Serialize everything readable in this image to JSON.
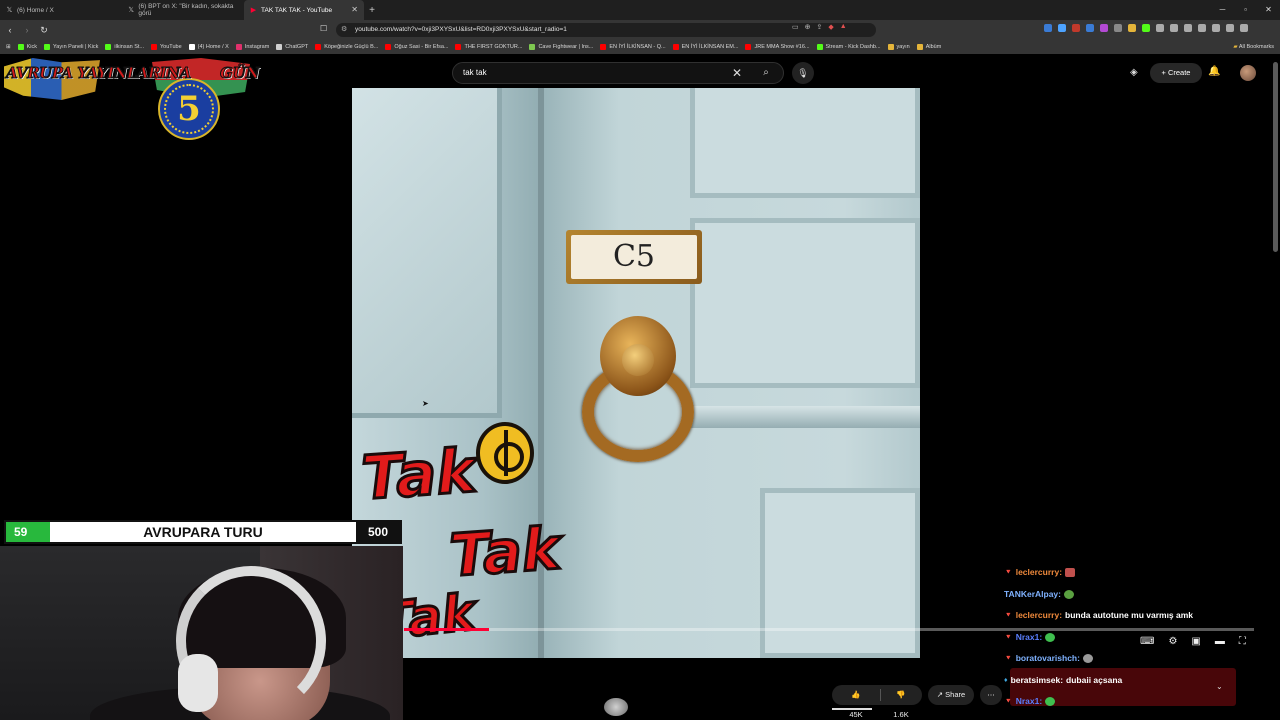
{
  "browser": {
    "tabs": [
      {
        "label": "(6) Home / X",
        "icon": "x-logo-icon",
        "active": false
      },
      {
        "label": "(6) BPT on X: \"Bir kadın, sokakta görü",
        "icon": "x-logo-icon",
        "active": false
      },
      {
        "label": "TAK TAK TAK - YouTube",
        "icon": "youtube-icon",
        "active": true
      }
    ],
    "new_tab": "+",
    "url": "youtube.com/watch?v=0xji3PXYSxU&list=RD0xji3PXYSxU&start_radio=1",
    "bookmarks": [
      {
        "label": "Kick",
        "color": "#53fc18"
      },
      {
        "label": "Yayın Paneli | Kick",
        "color": "#53fc18"
      },
      {
        "label": "ilkinsan St...",
        "color": "#53fc18"
      },
      {
        "label": "YouTube",
        "color": "#ff0000"
      },
      {
        "label": "(4) Home / X",
        "color": "#ffffff"
      },
      {
        "label": "Instagram",
        "color": "#e1306c"
      },
      {
        "label": "ChatGPT",
        "color": "#cfcfcf"
      },
      {
        "label": "Köpeğinizle Güçlü B...",
        "color": "#ff0000"
      },
      {
        "label": "Oğuz Sasi - Bir Efsa...",
        "color": "#ff0000"
      },
      {
        "label": "THE FIRST GOKTUR...",
        "color": "#ff0000"
      },
      {
        "label": "Cave Fightwear | Ins...",
        "color": "#7ec850"
      },
      {
        "label": "EN İYİ İLKİNSAN - Q...",
        "color": "#ff0000"
      },
      {
        "label": "EN İYİ İLKİNSAN EM...",
        "color": "#ff0000"
      },
      {
        "label": "JRE MMA Show #16...",
        "color": "#ff0000"
      },
      {
        "label": "Stream - Kick Dashb...",
        "color": "#53fc18"
      },
      {
        "label": "yayın",
        "color": "#e5b53a"
      },
      {
        "label": "Albüm",
        "color": "#e5b53a"
      }
    ],
    "all_bookmarks": "All Bookmarks"
  },
  "overlay": {
    "banner_text": "AVRUPA YAYINLARINA",
    "banner_number": "5",
    "banner_suffix": "GÜN",
    "counter_current": "59",
    "counter_title": "AVRUPARA TURU",
    "counter_max": "500"
  },
  "youtube": {
    "search_value": "tak tak",
    "create_label": "Create",
    "video_plate": "C5",
    "video_sticker_words": [
      "Tak",
      "Tak",
      "Tak"
    ],
    "progress_fraction": 0.1,
    "like_count": "45K",
    "dislike_count": "1.6K",
    "share_label": "Share"
  },
  "chat": {
    "messages": [
      {
        "user": "leclercurry:",
        "text": "",
        "user_color": "#f08a3c",
        "badge": true,
        "emote_color": "#c0504d"
      },
      {
        "user": "TANKerAlpay:",
        "text": "",
        "user_color": "#7fb2ff",
        "badge": false,
        "emote_color": "#5aa040"
      },
      {
        "user": "leclercurry:",
        "text": "bunda autotune mu varmış amk",
        "user_color": "#f08a3c",
        "badge": true,
        "emote_color": ""
      },
      {
        "user": "Nrax1:",
        "text": "",
        "user_color": "#5a7fff",
        "badge": true,
        "emote_color": "#3fbf4f"
      },
      {
        "user": "boratovarishch:",
        "text": "",
        "user_color": "#7fb2ff",
        "badge": true,
        "emote_color": "#9a9a9a"
      },
      {
        "user": "beratsimsek:",
        "text": "dubaii açsana",
        "user_color": "#ffffff",
        "badge": true,
        "emote_color": ""
      },
      {
        "user": "Nrax1:",
        "text": "",
        "user_color": "#5a7fff",
        "badge": true,
        "emote_color": "#3fbf4f"
      }
    ]
  },
  "colors": {
    "youtube_red": "#ff0033",
    "counter_green": "#28b83d",
    "chat_highlight": "#780a0f"
  }
}
